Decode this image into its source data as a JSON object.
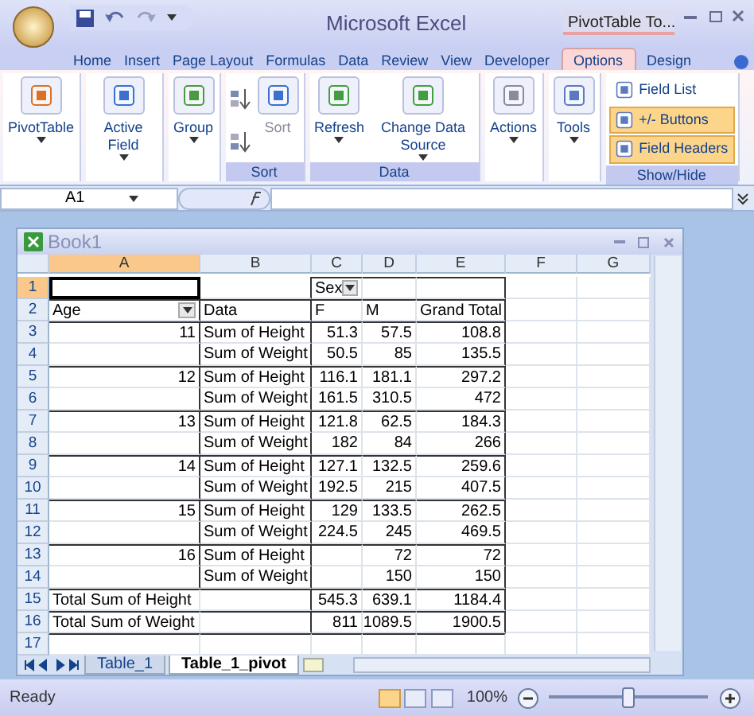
{
  "title_bar": {
    "title": "Microsoft Excel",
    "context_tab": "PivotTable To..."
  },
  "ribbon_tabs": [
    {
      "label": "Home",
      "selected": false
    },
    {
      "label": "Insert",
      "selected": false
    },
    {
      "label": "Page Layout",
      "selected": false
    },
    {
      "label": "Formulas",
      "selected": false
    },
    {
      "label": "Data",
      "selected": false
    },
    {
      "label": "Review",
      "selected": false
    },
    {
      "label": "View",
      "selected": false
    },
    {
      "label": "Developer",
      "selected": false
    },
    {
      "label": "Options",
      "selected": true
    },
    {
      "label": "Design",
      "selected": false
    }
  ],
  "ribbon_groups": [
    {
      "buttons": [
        {
          "kind": "large",
          "label": "PivotTable",
          "dropdown": true,
          "disabled": false
        }
      ]
    },
    {
      "buttons": [
        {
          "kind": "large",
          "label": "Active Field",
          "dropdown": true,
          "disabled": false
        }
      ]
    },
    {
      "buttons": [
        {
          "kind": "large",
          "label": "Group",
          "dropdown": true,
          "disabled": false
        }
      ]
    },
    {
      "label": "Sort",
      "buttons": [
        {
          "kind": "sort-pair"
        },
        {
          "kind": "large",
          "label": "Sort",
          "dropdown": false,
          "disabled": true
        }
      ]
    },
    {
      "label": "Data",
      "buttons": [
        {
          "kind": "large",
          "label": "Refresh",
          "dropdown": true,
          "disabled": false
        },
        {
          "kind": "large",
          "label": "Change Data Source",
          "dropdown": true,
          "disabled": false
        }
      ]
    },
    {
      "buttons": [
        {
          "kind": "large",
          "label": "Actions",
          "dropdown": true,
          "disabled": false
        }
      ]
    },
    {
      "buttons": [
        {
          "kind": "large",
          "label": "Tools",
          "dropdown": true,
          "disabled": false
        }
      ]
    },
    {
      "label": "Show/Hide",
      "buttons": [
        {
          "kind": "toggle",
          "label": "Field List",
          "on": false
        },
        {
          "kind": "toggle",
          "label": "+/- Buttons",
          "on": true
        },
        {
          "kind": "toggle",
          "label": "Field Headers",
          "on": true
        }
      ]
    }
  ],
  "formula_bar": {
    "name_box": "A1"
  },
  "workbook": {
    "title": "Book1",
    "columns": [
      {
        "label": "A",
        "selected": true
      },
      {
        "label": "B",
        "selected": false
      },
      {
        "label": "C",
        "selected": false
      },
      {
        "label": "D",
        "selected": false
      },
      {
        "label": "E",
        "selected": false
      },
      {
        "label": "F",
        "selected": false
      },
      {
        "label": "G",
        "selected": false
      }
    ],
    "rows": [
      {
        "number": "1",
        "selected": true,
        "kind": "filter",
        "cells": {
          "A": {
            "selected": true
          },
          "C": {
            "text": "Sex",
            "dropdown": true
          }
        }
      },
      {
        "number": "2",
        "selected": false,
        "kind": "header",
        "cells": {
          "A": {
            "text": "Age",
            "dropdown": true
          },
          "B": {
            "text": "Data"
          },
          "C": {
            "text": "F"
          },
          "D": {
            "text": "M"
          },
          "E": {
            "text": "Grand Total"
          }
        }
      },
      {
        "number": "3",
        "selected": false,
        "kind": "item",
        "cells": {
          "A": {
            "text": "11",
            "kind": "number"
          },
          "B": {
            "text": "Sum of Height"
          },
          "C": {
            "text": "51.3",
            "kind": "number"
          },
          "D": {
            "text": "57.5",
            "kind": "number"
          },
          "E": {
            "text": "108.8",
            "kind": "number"
          }
        }
      },
      {
        "number": "4",
        "selected": false,
        "kind": "item",
        "cells": {
          "B": {
            "text": "Sum of Weight"
          },
          "C": {
            "text": "50.5",
            "kind": "number"
          },
          "D": {
            "text": "85",
            "kind": "number"
          },
          "E": {
            "text": "135.5",
            "kind": "number"
          }
        }
      },
      {
        "number": "5",
        "selected": false,
        "kind": "item",
        "cells": {
          "A": {
            "text": "12",
            "kind": "number"
          },
          "B": {
            "text": "Sum of Height"
          },
          "C": {
            "text": "116.1",
            "kind": "number"
          },
          "D": {
            "text": "181.1",
            "kind": "number"
          },
          "E": {
            "text": "297.2",
            "kind": "number"
          }
        }
      },
      {
        "number": "6",
        "selected": false,
        "kind": "item",
        "cells": {
          "B": {
            "text": "Sum of Weight"
          },
          "C": {
            "text": "161.5",
            "kind": "number"
          },
          "D": {
            "text": "310.5",
            "kind": "number"
          },
          "E": {
            "text": "472",
            "kind": "number"
          }
        }
      },
      {
        "number": "7",
        "selected": false,
        "kind": "item",
        "cells": {
          "A": {
            "text": "13",
            "kind": "number"
          },
          "B": {
            "text": "Sum of Height"
          },
          "C": {
            "text": "121.8",
            "kind": "number"
          },
          "D": {
            "text": "62.5",
            "kind": "number"
          },
          "E": {
            "text": "184.3",
            "kind": "number"
          }
        }
      },
      {
        "number": "8",
        "selected": false,
        "kind": "item",
        "cells": {
          "B": {
            "text": "Sum of Weight"
          },
          "C": {
            "text": "182",
            "kind": "number"
          },
          "D": {
            "text": "84",
            "kind": "number"
          },
          "E": {
            "text": "266",
            "kind": "number"
          }
        }
      },
      {
        "number": "9",
        "selected": false,
        "kind": "item",
        "cells": {
          "A": {
            "text": "14",
            "kind": "number"
          },
          "B": {
            "text": "Sum of Height"
          },
          "C": {
            "text": "127.1",
            "kind": "number"
          },
          "D": {
            "text": "132.5",
            "kind": "number"
          },
          "E": {
            "text": "259.6",
            "kind": "number"
          }
        }
      },
      {
        "number": "10",
        "selected": false,
        "kind": "item",
        "cells": {
          "B": {
            "text": "Sum of Weight"
          },
          "C": {
            "text": "192.5",
            "kind": "number"
          },
          "D": {
            "text": "215",
            "kind": "number"
          },
          "E": {
            "text": "407.5",
            "kind": "number"
          }
        }
      },
      {
        "number": "11",
        "selected": false,
        "kind": "item",
        "cells": {
          "A": {
            "text": "15",
            "kind": "number"
          },
          "B": {
            "text": "Sum of Height"
          },
          "C": {
            "text": "129",
            "kind": "number"
          },
          "D": {
            "text": "133.5",
            "kind": "number"
          },
          "E": {
            "text": "262.5",
            "kind": "number"
          }
        }
      },
      {
        "number": "12",
        "selected": false,
        "kind": "item",
        "cells": {
          "B": {
            "text": "Sum of Weight"
          },
          "C": {
            "text": "224.5",
            "kind": "number"
          },
          "D": {
            "text": "245",
            "kind": "number"
          },
          "E": {
            "text": "469.5",
            "kind": "number"
          }
        }
      },
      {
        "number": "13",
        "selected": false,
        "kind": "item",
        "cells": {
          "A": {
            "text": "16",
            "kind": "number"
          },
          "B": {
            "text": "Sum of Height"
          },
          "D": {
            "text": "72",
            "kind": "number"
          },
          "E": {
            "text": "72",
            "kind": "number"
          }
        }
      },
      {
        "number": "14",
        "selected": false,
        "kind": "item",
        "cells": {
          "B": {
            "text": "Sum of Weight"
          },
          "D": {
            "text": "150",
            "kind": "number"
          },
          "E": {
            "text": "150",
            "kind": "number"
          }
        }
      },
      {
        "number": "15",
        "selected": false,
        "kind": "total",
        "cells": {
          "A": {
            "text": "Total Sum of Height"
          },
          "C": {
            "text": "545.3",
            "kind": "number"
          },
          "D": {
            "text": "639.1",
            "kind": "number"
          },
          "E": {
            "text": "1184.4",
            "kind": "number"
          }
        }
      },
      {
        "number": "16",
        "selected": false,
        "kind": "total",
        "cells": {
          "A": {
            "text": "Total Sum of Weight"
          },
          "C": {
            "text": "811",
            "kind": "number"
          },
          "D": {
            "text": "1089.5",
            "kind": "number"
          },
          "E": {
            "text": "1900.5",
            "kind": "number"
          }
        }
      },
      {
        "number": "17",
        "selected": false,
        "kind": "blank",
        "cells": {}
      }
    ],
    "sheet_tabs": [
      {
        "label": "Table_1",
        "selected": false
      },
      {
        "label": "Table_1_pivot",
        "selected": true
      }
    ]
  },
  "status_bar": {
    "status": "Ready",
    "views": [
      {
        "selected": true
      },
      {
        "selected": false
      },
      {
        "selected": false
      }
    ],
    "zoom": "100%",
    "zoom_slider": {
      "level": 0.5
    }
  }
}
